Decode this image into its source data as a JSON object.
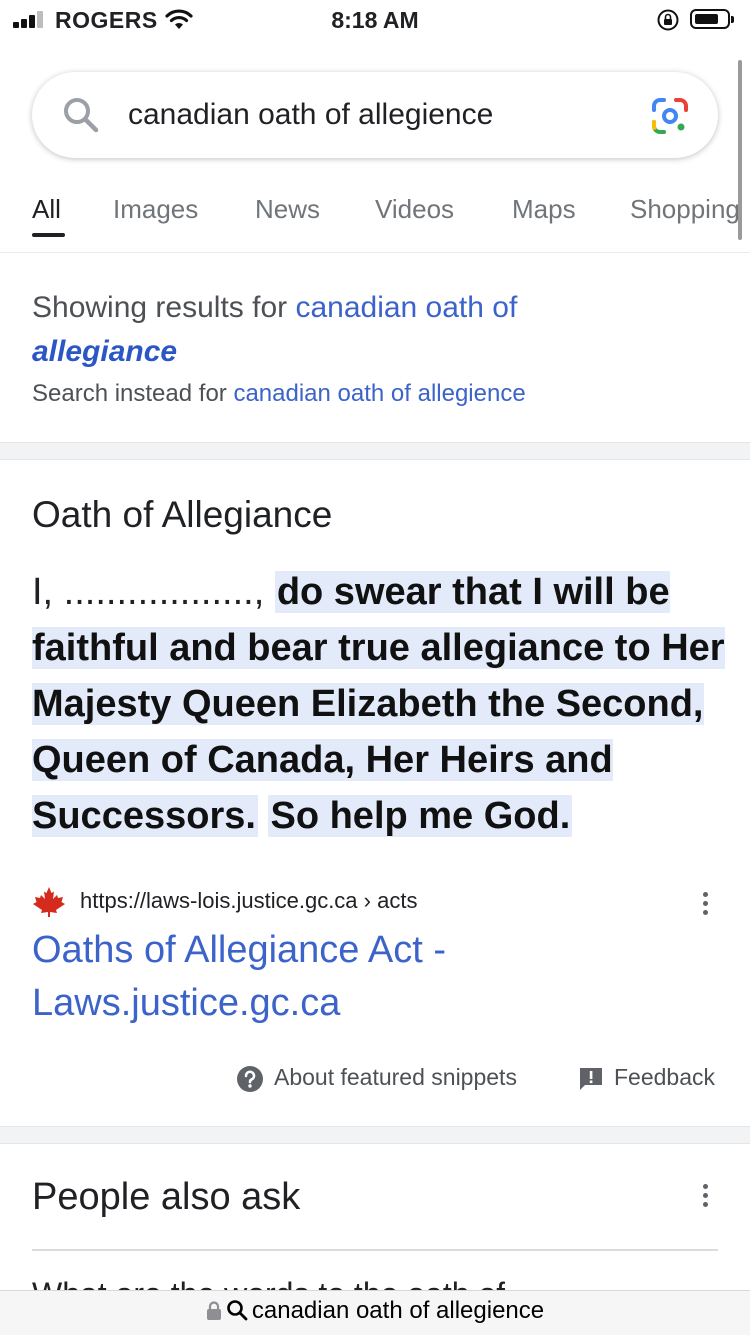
{
  "status_bar": {
    "carrier": "ROGERS",
    "time": "8:18 AM"
  },
  "search": {
    "query": "canadian oath of allegience"
  },
  "tabs": [
    {
      "label": "All",
      "active": true
    },
    {
      "label": "Images",
      "active": false
    },
    {
      "label": "News",
      "active": false
    },
    {
      "label": "Videos",
      "active": false
    },
    {
      "label": "Maps",
      "active": false
    },
    {
      "label": "Shopping",
      "active": false
    }
  ],
  "spelling": {
    "showing_prefix": "Showing results for ",
    "showing_link": "canadian oath of",
    "corrected_word": "allegiance",
    "instead_prefix": "Search instead for ",
    "instead_link": "canadian oath of allegience"
  },
  "featured_snippet": {
    "title": "Oath of Allegiance",
    "prefix": "I, .................., ",
    "highlight_1": "do swear that I will be faithful and bear true allegiance to Her Majesty Queen Elizabeth the Second, Queen of Canada, Her Heirs and Successors.",
    "highlight_2": "So help me God.",
    "source_url": "https://laws-lois.justice.gc.ca › acts",
    "link_title": "Oaths of Allegiance Act - Laws.justice.gc.ca",
    "about_label": "About featured snippets",
    "feedback_label": "Feedback"
  },
  "people_also_ask": {
    "title": "People also ask",
    "first_question_partial": "What are the words to the oath of"
  },
  "url_bar": {
    "text": "canadian oath of allegience"
  },
  "colors": {
    "link": "#3c63c9",
    "highlight": "#e3ebfb",
    "text": "#202124",
    "secondary": "#70757a"
  }
}
